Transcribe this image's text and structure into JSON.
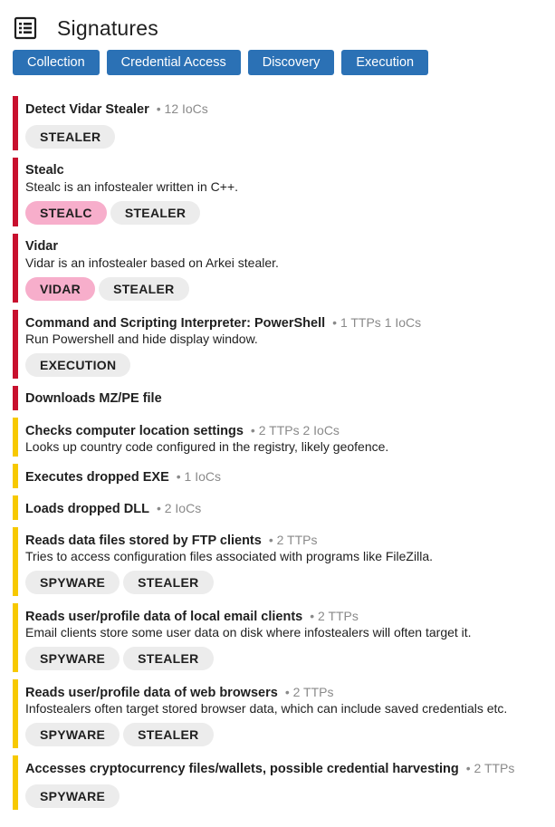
{
  "header": {
    "title": "Signatures",
    "icon": "list-icon"
  },
  "tabs": [
    "Collection",
    "Credential Access",
    "Discovery",
    "Execution"
  ],
  "colors": {
    "tab_bg": "#2b71b5",
    "severity_high": "#c8102e",
    "severity_medium": "#f7c900",
    "family_tag": "#f7aecb",
    "tag": "#ececec"
  },
  "signatures": [
    {
      "name": "Detect Vidar Stealer",
      "meta": "12 IoCs",
      "severity": "high",
      "desc": "",
      "tags": [
        {
          "label": "STEALER",
          "family": false
        }
      ]
    },
    {
      "name": "Stealc",
      "meta": "",
      "severity": "high",
      "desc": "Stealc is an infostealer written in C++.",
      "tags": [
        {
          "label": "STEALC",
          "family": true
        },
        {
          "label": "STEALER",
          "family": false
        }
      ]
    },
    {
      "name": "Vidar",
      "meta": "",
      "severity": "high",
      "desc": "Vidar is an infostealer based on Arkei stealer.",
      "tags": [
        {
          "label": "VIDAR",
          "family": true
        },
        {
          "label": "STEALER",
          "family": false
        }
      ]
    },
    {
      "name": "Command and Scripting Interpreter: PowerShell",
      "meta": "1 TTPs 1 IoCs",
      "severity": "high",
      "desc": "Run Powershell and hide display window.",
      "tags": [
        {
          "label": "EXECUTION",
          "family": false
        }
      ]
    },
    {
      "name": "Downloads MZ/PE file",
      "meta": "",
      "severity": "high",
      "desc": "",
      "tags": []
    },
    {
      "name": "Checks computer location settings",
      "meta": "2 TTPs 2 IoCs",
      "severity": "medium",
      "desc": "Looks up country code configured in the registry, likely geofence.",
      "tags": []
    },
    {
      "name": "Executes dropped EXE",
      "meta": "1 IoCs",
      "severity": "medium",
      "desc": "",
      "tags": []
    },
    {
      "name": "Loads dropped DLL",
      "meta": "2 IoCs",
      "severity": "medium",
      "desc": "",
      "tags": []
    },
    {
      "name": "Reads data files stored by FTP clients",
      "meta": "2 TTPs",
      "severity": "medium",
      "desc": "Tries to access configuration files associated with programs like FileZilla.",
      "tags": [
        {
          "label": "SPYWARE",
          "family": false
        },
        {
          "label": "STEALER",
          "family": false
        }
      ]
    },
    {
      "name": "Reads user/profile data of local email clients",
      "meta": "2 TTPs",
      "severity": "medium",
      "desc": "Email clients store some user data on disk where infostealers will often target it.",
      "tags": [
        {
          "label": "SPYWARE",
          "family": false
        },
        {
          "label": "STEALER",
          "family": false
        }
      ]
    },
    {
      "name": "Reads user/profile data of web browsers",
      "meta": "2 TTPs",
      "severity": "medium",
      "desc": "Infostealers often target stored browser data, which can include saved credentials etc.",
      "tags": [
        {
          "label": "SPYWARE",
          "family": false
        },
        {
          "label": "STEALER",
          "family": false
        }
      ]
    },
    {
      "name": "Accesses cryptocurrency files/wallets, possible credential harvesting",
      "meta": "2 TTPs",
      "severity": "medium",
      "desc": "",
      "tags": [
        {
          "label": "SPYWARE",
          "family": false
        }
      ]
    }
  ]
}
